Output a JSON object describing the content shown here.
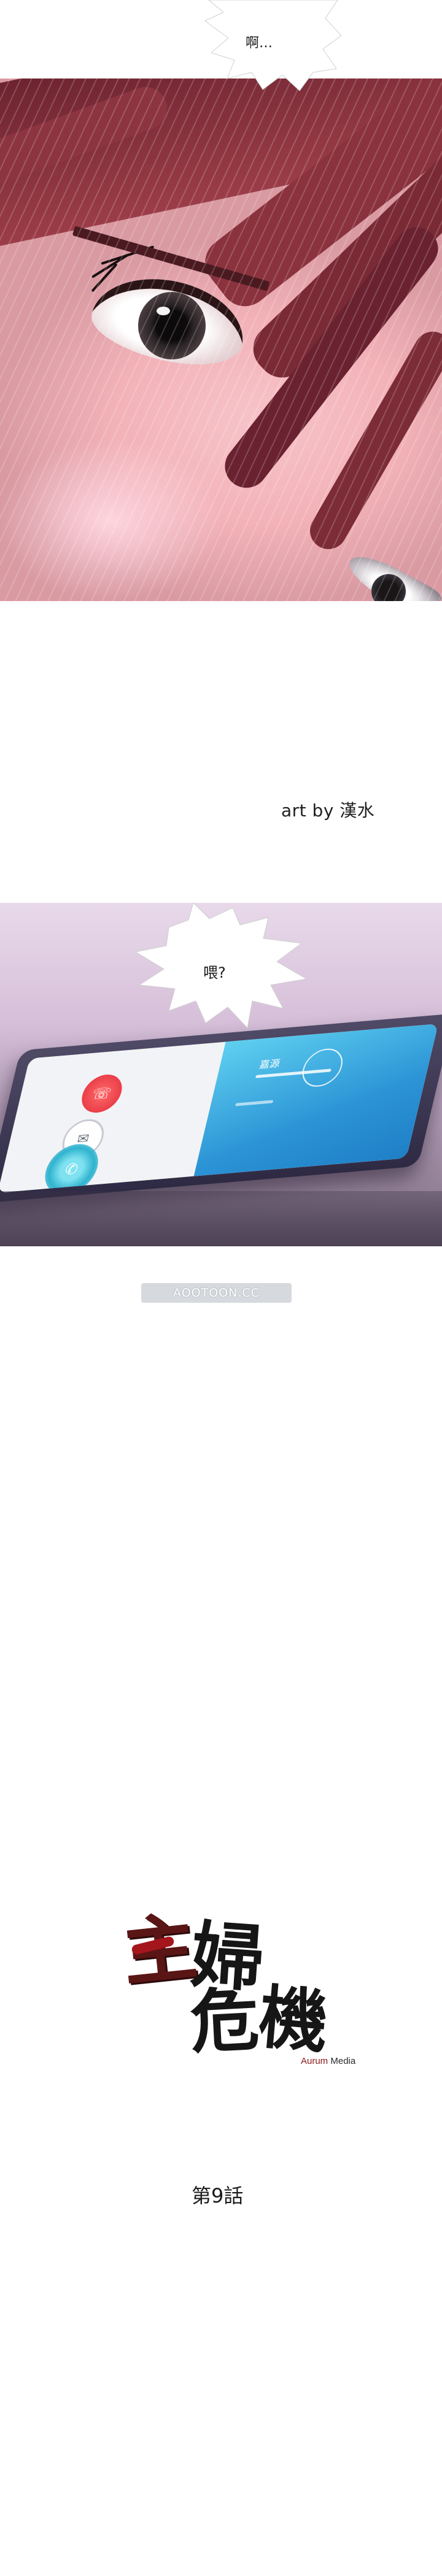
{
  "panel_eye": {
    "bubble_text": "啊…"
  },
  "credit": {
    "text": "art by 漢水"
  },
  "panel_phone": {
    "bubble_text": "喂?",
    "caller_name": "嘉源"
  },
  "watermark": {
    "text": "AOOTOON.CC"
  },
  "title": {
    "char_1": "主",
    "char_2": "婦",
    "char_3": "危",
    "char_4": "機",
    "publisher_part1": "Aurum",
    "publisher_part2": " Media"
  },
  "episode": {
    "label": "第9話"
  },
  "colors": {
    "hair": "#7a2a35",
    "skin": "#f2b2b8",
    "phone_accent": "#2c94d6",
    "decline": "#e12c3a",
    "logo_red": "#5a1515"
  },
  "icons": [
    "phone-decline-icon",
    "message-icon",
    "phone-accept-icon",
    "caller-avatar-icon"
  ]
}
